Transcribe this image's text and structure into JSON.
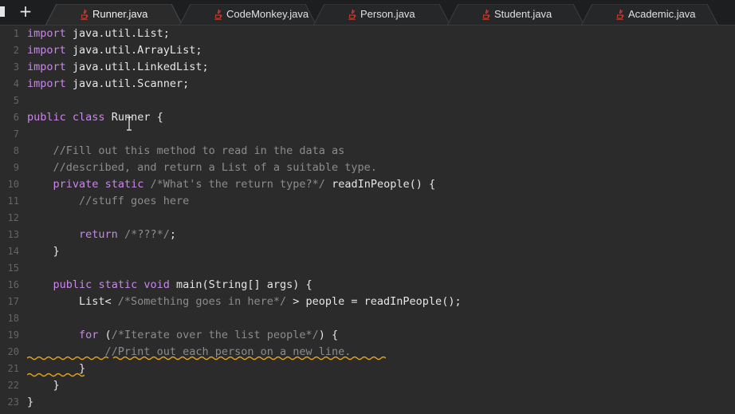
{
  "tabs": [
    {
      "label": "Runner.java",
      "active": true
    },
    {
      "label": "CodeMonkey.java",
      "active": false
    },
    {
      "label": "Person.java",
      "active": false
    },
    {
      "label": "Student.java",
      "active": false
    },
    {
      "label": "Academic.java",
      "active": false
    }
  ],
  "new_tab_label": "+",
  "editor": {
    "line_numbers": [
      "1",
      "2",
      "3",
      "4",
      "5",
      "6",
      "7",
      "8",
      "9",
      "10",
      "11",
      "12",
      "13",
      "14",
      "15",
      "16",
      "17",
      "18",
      "19",
      "20",
      "21",
      "22",
      "23"
    ],
    "lines": [
      [
        {
          "t": "import",
          "c": "kw"
        },
        {
          "t": " java.util.List;",
          "c": "id"
        }
      ],
      [
        {
          "t": "import",
          "c": "kw"
        },
        {
          "t": " java.util.ArrayList;",
          "c": "id"
        }
      ],
      [
        {
          "t": "import",
          "c": "kw"
        },
        {
          "t": " java.util.LinkedList;",
          "c": "id"
        }
      ],
      [
        {
          "t": "import",
          "c": "kw"
        },
        {
          "t": " java.util.Scanner;",
          "c": "id"
        }
      ],
      [],
      [
        {
          "t": "public",
          "c": "kw"
        },
        {
          "t": " ",
          "c": "id"
        },
        {
          "t": "class",
          "c": "kw"
        },
        {
          "t": " Runner {",
          "c": "id"
        }
      ],
      [],
      [
        {
          "t": "    ",
          "c": "id"
        },
        {
          "t": "//Fill out this method to read in the data as",
          "c": "cm"
        }
      ],
      [
        {
          "t": "    ",
          "c": "id"
        },
        {
          "t": "//described, and return a List of a suitable type.",
          "c": "cm"
        }
      ],
      [
        {
          "t": "    ",
          "c": "id"
        },
        {
          "t": "private",
          "c": "kw"
        },
        {
          "t": " ",
          "c": "id"
        },
        {
          "t": "static",
          "c": "kw"
        },
        {
          "t": " ",
          "c": "id"
        },
        {
          "t": "/*What's the return type?*/",
          "c": "cm"
        },
        {
          "t": " readInPeople() {",
          "c": "id"
        }
      ],
      [
        {
          "t": "        ",
          "c": "id"
        },
        {
          "t": "//stuff goes here",
          "c": "cm"
        }
      ],
      [],
      [
        {
          "t": "        ",
          "c": "id"
        },
        {
          "t": "return",
          "c": "kw"
        },
        {
          "t": " ",
          "c": "id"
        },
        {
          "t": "/*???*/",
          "c": "cm"
        },
        {
          "t": ";",
          "c": "id"
        }
      ],
      [
        {
          "t": "    }",
          "c": "id"
        }
      ],
      [],
      [
        {
          "t": "    ",
          "c": "id"
        },
        {
          "t": "public",
          "c": "kw"
        },
        {
          "t": " ",
          "c": "id"
        },
        {
          "t": "static",
          "c": "kw"
        },
        {
          "t": " ",
          "c": "id"
        },
        {
          "t": "void",
          "c": "kw"
        },
        {
          "t": " main(String[] args) {",
          "c": "id"
        }
      ],
      [
        {
          "t": "        List< ",
          "c": "id"
        },
        {
          "t": "/*Something goes in here*/",
          "c": "cm"
        },
        {
          "t": " > people = readInPeople();",
          "c": "id"
        }
      ],
      [],
      [
        {
          "t": "        ",
          "c": "id"
        },
        {
          "t": "for",
          "c": "kw"
        },
        {
          "t": " (",
          "c": "id"
        },
        {
          "t": "/*Iterate over the list people*/",
          "c": "cm"
        },
        {
          "t": ") {",
          "c": "id"
        }
      ],
      [
        {
          "t": "            ",
          "c": "id"
        },
        {
          "t": "//Print out each person on a new line.",
          "c": "cm"
        }
      ],
      [
        {
          "t": "        }",
          "c": "id"
        }
      ],
      [
        {
          "t": "    }",
          "c": "id"
        }
      ],
      [
        {
          "t": "}",
          "c": "id"
        }
      ]
    ]
  },
  "colors": {
    "keyword": "#c788e6",
    "comment": "#8c8c8c",
    "text": "#e6e6e6",
    "line_number": "#646464",
    "squiggle": "#e0a11b",
    "java_icon": "#c0392b"
  },
  "icons": {
    "tab_file_icon": "java-file-icon",
    "text_cursor": "ibeam-cursor-icon"
  }
}
